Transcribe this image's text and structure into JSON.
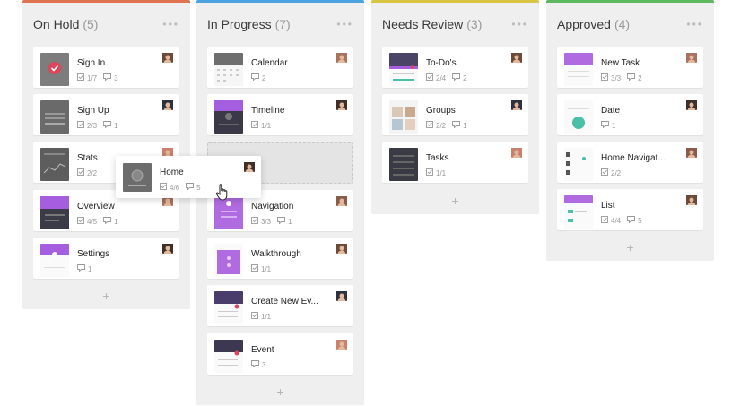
{
  "board": {
    "columns": [
      {
        "title": "On Hold",
        "count": "(5)",
        "accent": "#e0734f",
        "cards": [
          {
            "title": "Sign In",
            "checks": "1/7",
            "comments": "3"
          },
          {
            "title": "Sign Up",
            "checks": "2/3",
            "comments": "1"
          },
          {
            "title": "Stats",
            "checks": "2/2",
            "comments": ""
          },
          {
            "title": "Overview",
            "checks": "4/5",
            "comments": "1"
          },
          {
            "title": "Settings",
            "checks": "",
            "comments": "1"
          }
        ]
      },
      {
        "title": "In Progress",
        "count": "(7)",
        "accent": "#4aa3df",
        "cards": [
          {
            "title": "Calendar",
            "checks": "",
            "comments": "2"
          },
          {
            "title": "Timeline",
            "checks": "1/1",
            "comments": ""
          },
          {
            "title": "Navigation",
            "checks": "3/3",
            "comments": "1"
          },
          {
            "title": "Walkthrough",
            "checks": "1/1",
            "comments": ""
          },
          {
            "title": "Create New Ev...",
            "checks": "1/1",
            "comments": ""
          },
          {
            "title": "Event",
            "checks": "",
            "comments": "3"
          }
        ]
      },
      {
        "title": "Needs Review",
        "count": "(3)",
        "accent": "#d9c441",
        "cards": [
          {
            "title": "To-Do's",
            "checks": "2/4",
            "comments": "2"
          },
          {
            "title": "Groups",
            "checks": "2/2",
            "comments": "1"
          },
          {
            "title": "Tasks",
            "checks": "1/1",
            "comments": ""
          }
        ]
      },
      {
        "title": "Approved",
        "count": "(4)",
        "accent": "#5cb85c",
        "cards": [
          {
            "title": "New Task",
            "checks": "3/3",
            "comments": "2"
          },
          {
            "title": "Date",
            "checks": "",
            "comments": "1"
          },
          {
            "title": "Home Navigat...",
            "checks": "2/2",
            "comments": ""
          },
          {
            "title": "List",
            "checks": "4/4",
            "comments": "5"
          }
        ]
      }
    ]
  },
  "dragging_card": {
    "title": "Home",
    "checks": "4/6",
    "comments": "5"
  },
  "icons": {
    "menu": "more-dots-icon",
    "add": "plus-icon",
    "checklist": "checkbox-icon",
    "comment": "comment-icon",
    "cursor": "hand-cursor-icon"
  },
  "symbols": {
    "dots": "•••",
    "plus": "+"
  }
}
